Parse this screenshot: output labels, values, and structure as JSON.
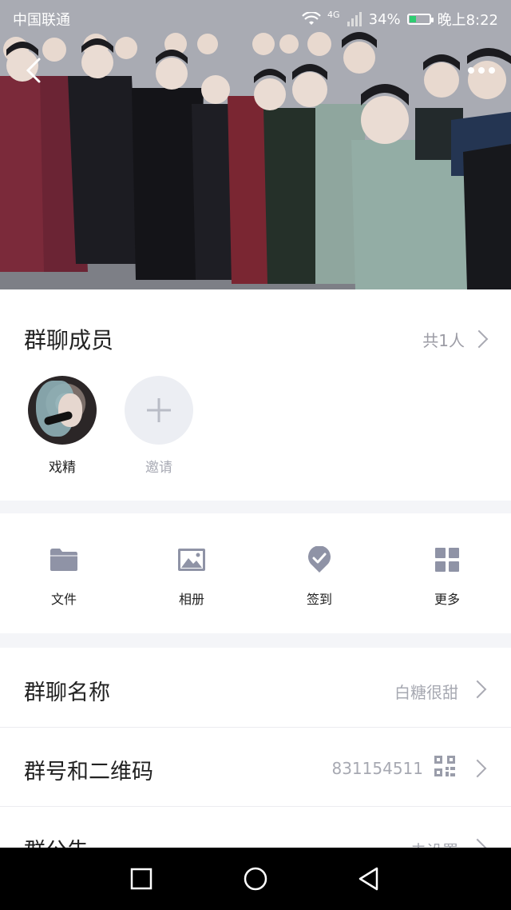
{
  "status_bar": {
    "carrier": "中国联通",
    "network": "4G",
    "battery": "34%",
    "battery_level": 0.34,
    "time": "晚上8:22"
  },
  "members": {
    "title": "群聊成员",
    "count": "共1人",
    "list": [
      {
        "name": "戏精"
      }
    ],
    "invite_label": "邀请"
  },
  "tools": [
    {
      "label": "文件",
      "icon": "folder-icon"
    },
    {
      "label": "相册",
      "icon": "image-icon"
    },
    {
      "label": "签到",
      "icon": "checkin-icon"
    },
    {
      "label": "更多",
      "icon": "grid-icon"
    }
  ],
  "settings": {
    "group_name_label": "群聊名称",
    "group_name_value": "白糖很甜",
    "group_id_label": "群号和二维码",
    "group_id_value": "831154511",
    "announcement_label": "群公告",
    "announcement_value": "未设置"
  },
  "colors": {
    "accent_icon": "#8f93a6",
    "muted_text": "#a7a9b2",
    "battery_green": "#2ecc71"
  }
}
